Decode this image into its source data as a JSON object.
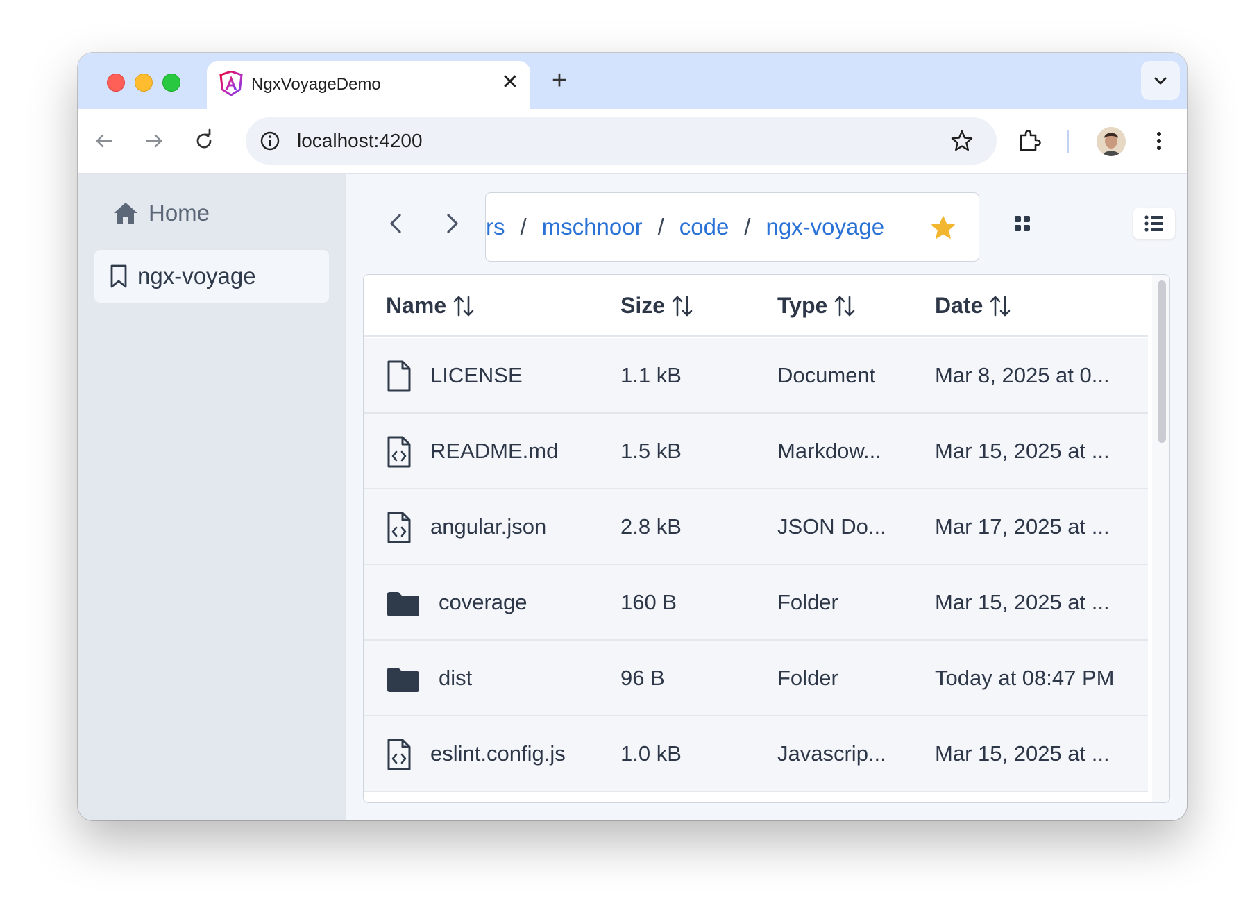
{
  "browser": {
    "tab_title": "NgxVoyageDemo",
    "tab_close": "✕",
    "new_tab": "+",
    "url": "localhost:4200"
  },
  "sidebar": {
    "home_label": "Home",
    "bookmark_label": "ngx-voyage"
  },
  "breadcrumb": {
    "items": [
      "rs",
      "mschnoor",
      "code",
      "ngx-voyage"
    ],
    "separator": "/"
  },
  "colors": {
    "link": "#2a72d6",
    "favorite_star": "#f2b631",
    "icon_dark": "#2f3a4b"
  },
  "table": {
    "headers": [
      "Name",
      "Size",
      "Type",
      "Date"
    ],
    "sort_icon": "sort-arrows-icon",
    "rows": [
      {
        "icon": "file-icon",
        "name": "LICENSE",
        "size": "1.1 kB",
        "type": "Document",
        "date": "Mar 8, 2025 at 0..."
      },
      {
        "icon": "code-file-icon",
        "name": "README.md",
        "size": "1.5 kB",
        "type": "Markdow...",
        "date": "Mar 15, 2025 at ..."
      },
      {
        "icon": "code-file-icon",
        "name": "angular.json",
        "size": "2.8 kB",
        "type": "JSON Do...",
        "date": "Mar 17, 2025 at ..."
      },
      {
        "icon": "folder-icon",
        "name": "coverage",
        "size": "160 B",
        "type": "Folder",
        "date": "Mar 15, 2025 at ..."
      },
      {
        "icon": "folder-icon",
        "name": "dist",
        "size": "96 B",
        "type": "Folder",
        "date": "Today at 08:47 PM"
      },
      {
        "icon": "code-file-icon",
        "name": "eslint.config.js",
        "size": "1.0 kB",
        "type": "Javascrip...",
        "date": "Mar 15, 2025 at ..."
      }
    ]
  }
}
